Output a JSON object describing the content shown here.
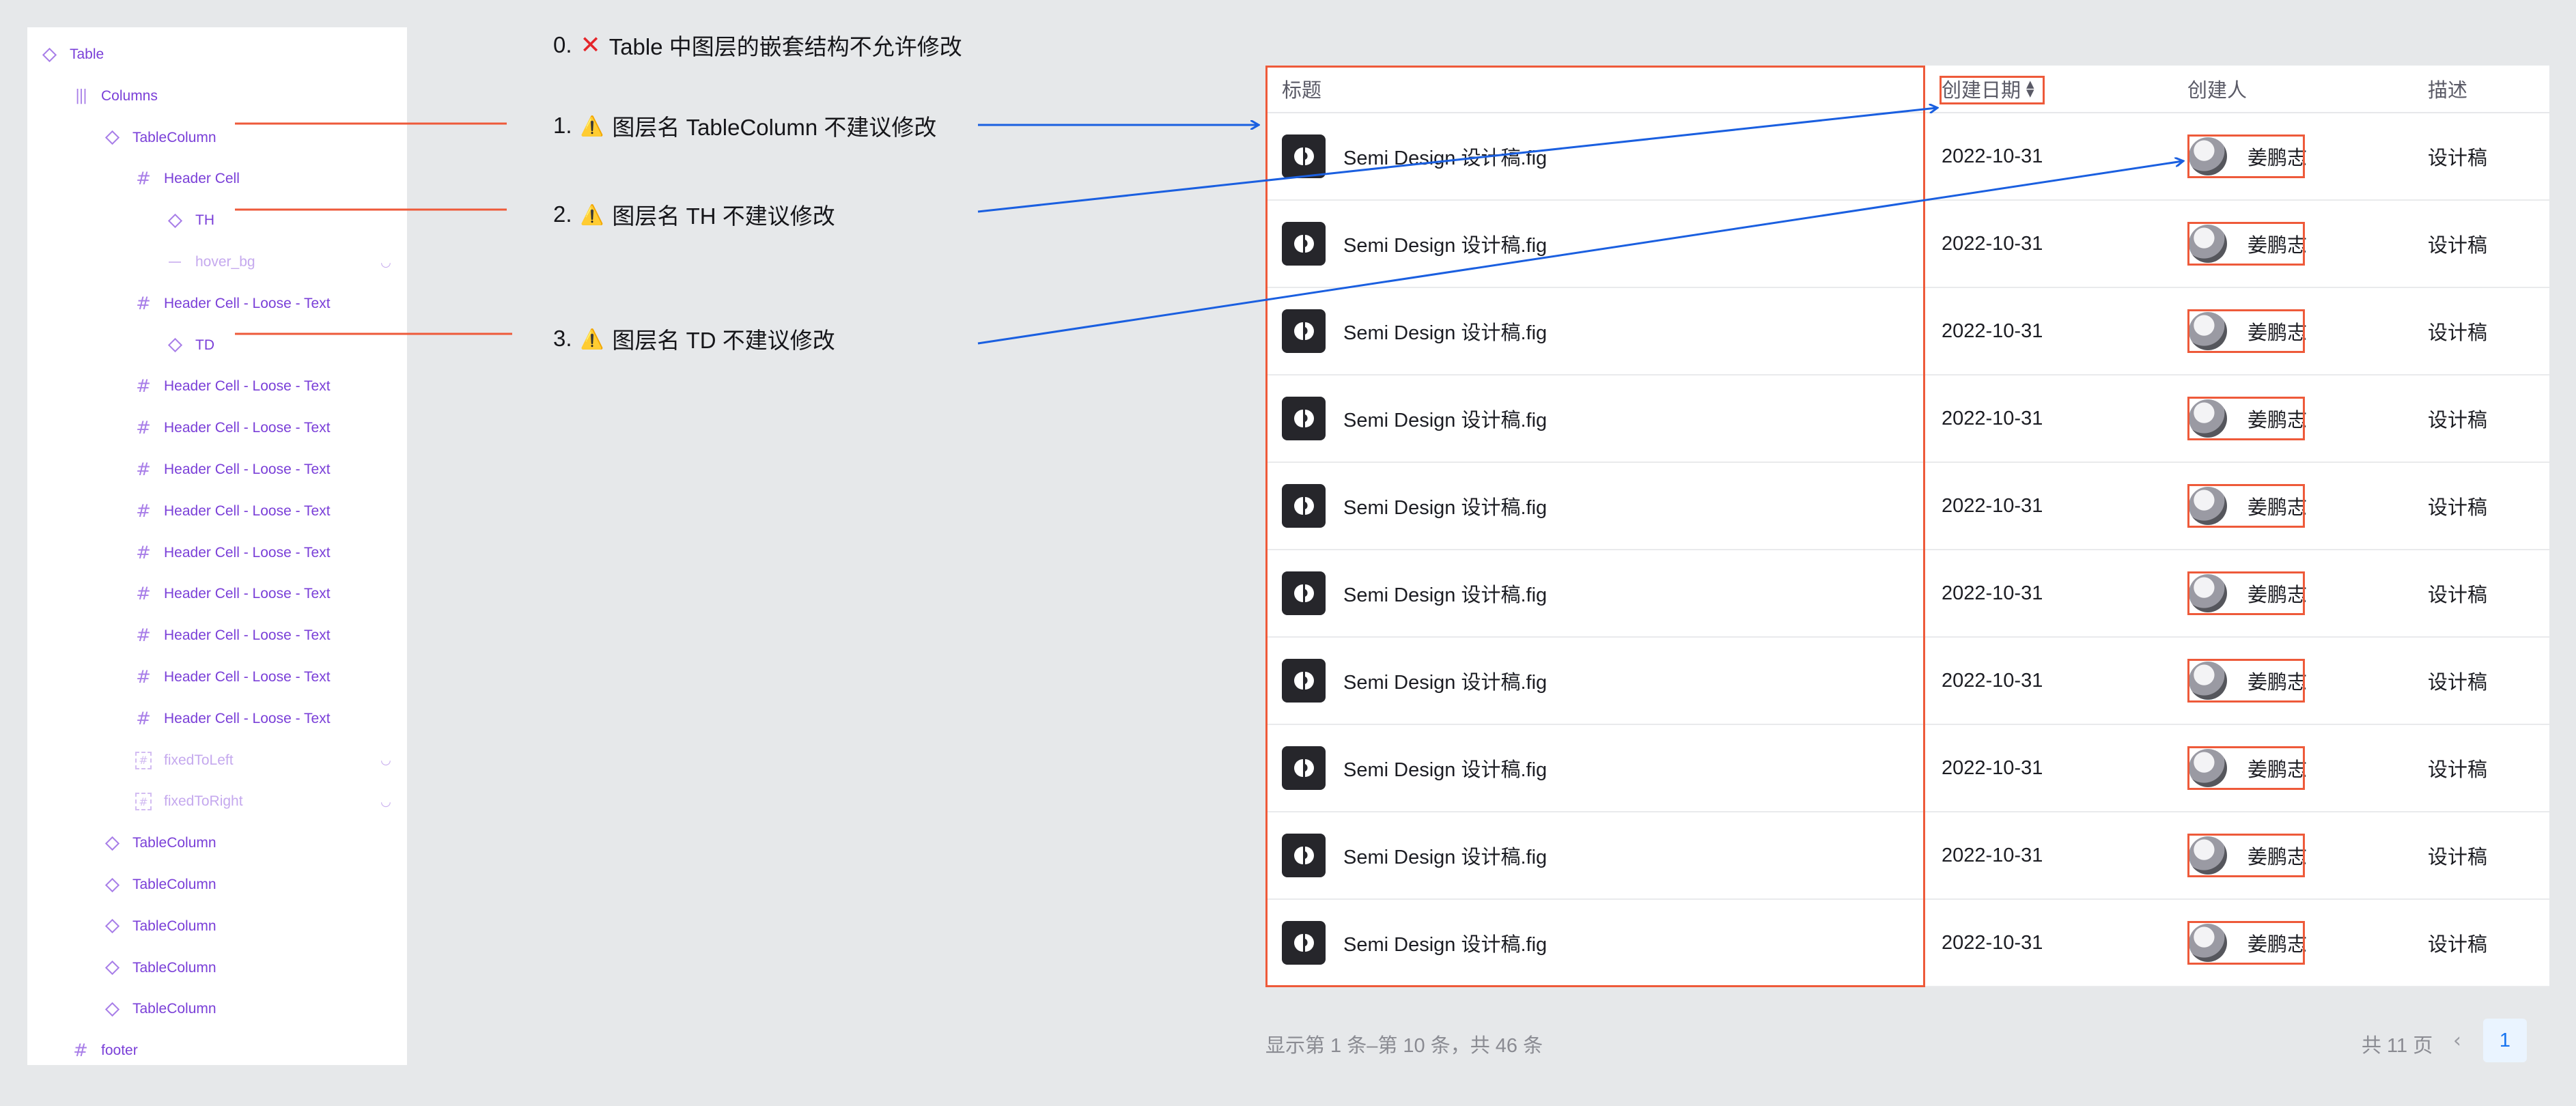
{
  "layers": [
    {
      "name": "Table",
      "icon": "component-icon"
    },
    {
      "name": "Columns",
      "icon": "columns-icon"
    },
    {
      "name": "TableColumn",
      "icon": "component-icon"
    },
    {
      "name": "Header Cell",
      "icon": "frame-icon"
    },
    {
      "name": "TH",
      "icon": "component-icon"
    },
    {
      "name": "hover_bg",
      "icon": "line-icon",
      "hidden": true
    },
    {
      "name": "Header Cell - Loose - Text",
      "icon": "frame-icon"
    },
    {
      "name": "TD",
      "icon": "component-icon"
    },
    {
      "name": "Header Cell - Loose - Text",
      "icon": "frame-icon"
    },
    {
      "name": "Header Cell - Loose - Text",
      "icon": "frame-icon"
    },
    {
      "name": "Header Cell - Loose - Text",
      "icon": "frame-icon"
    },
    {
      "name": "Header Cell - Loose - Text",
      "icon": "frame-icon"
    },
    {
      "name": "Header Cell - Loose - Text",
      "icon": "frame-icon"
    },
    {
      "name": "Header Cell - Loose - Text",
      "icon": "frame-icon"
    },
    {
      "name": "Header Cell - Loose - Text",
      "icon": "frame-icon"
    },
    {
      "name": "Header Cell - Loose - Text",
      "icon": "frame-icon"
    },
    {
      "name": "Header Cell - Loose - Text",
      "icon": "frame-icon"
    },
    {
      "name": "fixedToLeft",
      "icon": "frame-icon",
      "hidden": true
    },
    {
      "name": "fixedToRight",
      "icon": "frame-icon",
      "hidden": true
    },
    {
      "name": "TableColumn",
      "icon": "component-icon"
    },
    {
      "name": "TableColumn",
      "icon": "component-icon"
    },
    {
      "name": "TableColumn",
      "icon": "component-icon"
    },
    {
      "name": "TableColumn",
      "icon": "component-icon"
    },
    {
      "name": "TableColumn",
      "icon": "component-icon"
    },
    {
      "name": "footer",
      "icon": "frame-icon"
    }
  ],
  "annotations": {
    "rule0": {
      "num": "0.",
      "text": "Table 中图层的嵌套结构不允许修改"
    },
    "rule1": {
      "num": "1.",
      "text": "图层名 TableColumn 不建议修改"
    },
    "rule2": {
      "num": "2.",
      "text": "图层名 TH 不建议修改"
    },
    "rule3": {
      "num": "3.",
      "text": "图层名 TD 不建议修改"
    }
  },
  "table": {
    "headers": {
      "title": "标题",
      "date": "创建日期",
      "owner": "创建人",
      "desc": "描述"
    },
    "rows": [
      {
        "title": "Semi Design 设计稿.fig",
        "date": "2022-10-31",
        "owner": "姜鹏志",
        "desc": "设计稿"
      },
      {
        "title": "Semi Design 设计稿.fig",
        "date": "2022-10-31",
        "owner": "姜鹏志",
        "desc": "设计稿"
      },
      {
        "title": "Semi Design 设计稿.fig",
        "date": "2022-10-31",
        "owner": "姜鹏志",
        "desc": "设计稿"
      },
      {
        "title": "Semi Design 设计稿.fig",
        "date": "2022-10-31",
        "owner": "姜鹏志",
        "desc": "设计稿"
      },
      {
        "title": "Semi Design 设计稿.fig",
        "date": "2022-10-31",
        "owner": "姜鹏志",
        "desc": "设计稿"
      },
      {
        "title": "Semi Design 设计稿.fig",
        "date": "2022-10-31",
        "owner": "姜鹏志",
        "desc": "设计稿"
      },
      {
        "title": "Semi Design 设计稿.fig",
        "date": "2022-10-31",
        "owner": "姜鹏志",
        "desc": "设计稿"
      },
      {
        "title": "Semi Design 设计稿.fig",
        "date": "2022-10-31",
        "owner": "姜鹏志",
        "desc": "设计稿"
      },
      {
        "title": "Semi Design 设计稿.fig",
        "date": "2022-10-31",
        "owner": "姜鹏志",
        "desc": "设计稿"
      },
      {
        "title": "Semi Design 设计稿.fig",
        "date": "2022-10-31",
        "owner": "姜鹏志",
        "desc": "设计稿"
      }
    ]
  },
  "pagination": {
    "summary": "显示第 1 条–第 10 条，共 46 条",
    "total_pages": "共 11 页",
    "current_page": "1"
  },
  "colors": {
    "accent": "#7a3fd8",
    "highlight": "#ee5a3a",
    "arrow": "#1a5fe0",
    "page_active": "#1673f0"
  }
}
